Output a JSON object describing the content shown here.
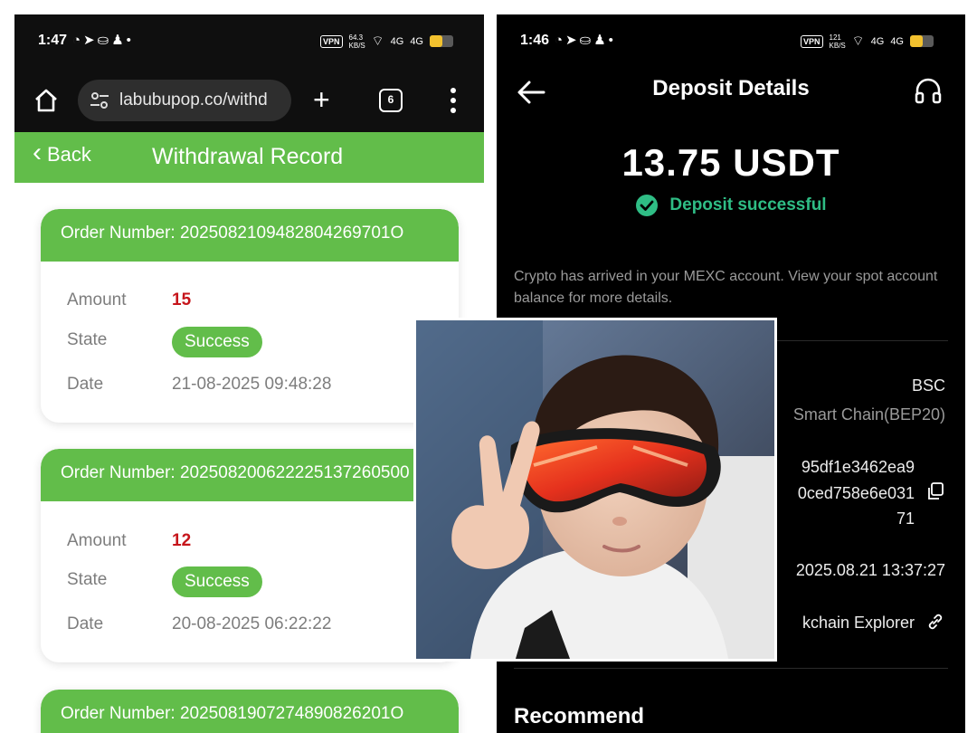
{
  "left": {
    "status": {
      "time": "1:47",
      "net_speed": "64.3 KB/S",
      "signal_1": "4G",
      "signal_2": "4G"
    },
    "browser": {
      "url": "labubupop.co/withd",
      "tabs_count": "6"
    },
    "header": {
      "back_label": "Back",
      "title": "Withdrawal Record"
    },
    "labels": {
      "amount": "Amount",
      "state": "State",
      "date": "Date"
    },
    "records": [
      {
        "order": "Order Number: 2025082109482804269701O",
        "amount": "15",
        "state": "Success",
        "date": "21-08-2025 09:48:28"
      },
      {
        "order": "Order Number: 202508200622225137260500",
        "amount": "12",
        "state": "Success",
        "date": "20-08-2025 06:22:22"
      },
      {
        "order": "Order Number: 2025081907274890826201O",
        "amount": "",
        "state": "",
        "date": ""
      }
    ]
  },
  "right": {
    "status": {
      "time": "1:46",
      "net_speed": "121 KB/S",
      "signal_1": "4G",
      "signal_2": "4G"
    },
    "title": "Deposit Details",
    "amount": "13.75 USDT",
    "status_text": "Deposit successful",
    "note": "Crypto has arrived in your MEXC account. View your spot account balance for more details.",
    "network_short": "BSC",
    "network_full": "Smart Chain(BEP20)",
    "txid_line1": "95df1e3462ea9",
    "txid_line2": "0ced758e6e031",
    "txid_line3": "71",
    "time": "2025.08.21 13:37:27",
    "explorer": "kchain Explorer",
    "recommend": "Recommend"
  },
  "colors": {
    "green": "#62bd4a",
    "amount_red": "#c6151b",
    "mexc_green": "#2fbd85"
  }
}
